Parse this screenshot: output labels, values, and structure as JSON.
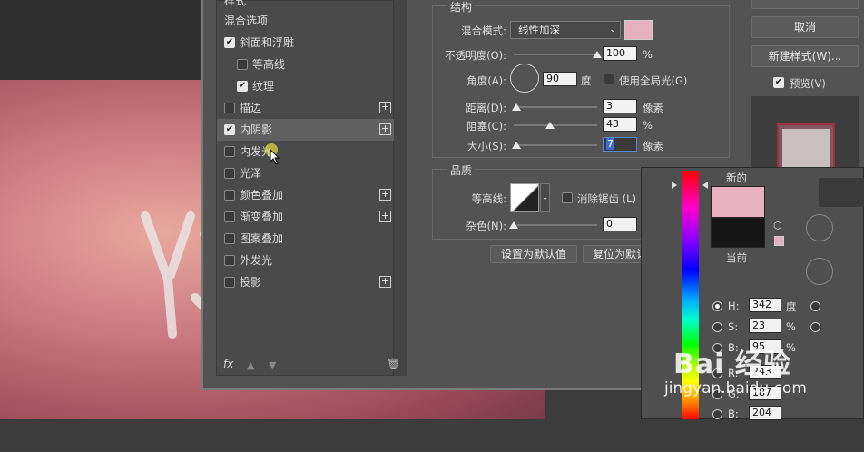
{
  "left_panel": {
    "header": "样式",
    "items": [
      {
        "label": "混合选项",
        "checkbox": false,
        "checked": false,
        "indent": 0,
        "plus": false
      },
      {
        "label": "斜面和浮雕",
        "checkbox": true,
        "checked": true,
        "indent": 0,
        "plus": false
      },
      {
        "label": "等高线",
        "checkbox": true,
        "checked": false,
        "indent": 1,
        "plus": false
      },
      {
        "label": "纹理",
        "checkbox": true,
        "checked": true,
        "indent": 1,
        "plus": false
      },
      {
        "label": "描边",
        "checkbox": true,
        "checked": false,
        "indent": 0,
        "plus": true
      },
      {
        "label": "内阴影",
        "checkbox": true,
        "checked": true,
        "indent": 0,
        "plus": true,
        "selected": true
      },
      {
        "label": "内发光",
        "checkbox": true,
        "checked": false,
        "indent": 0,
        "plus": false
      },
      {
        "label": "光泽",
        "checkbox": true,
        "checked": false,
        "indent": 0,
        "plus": false
      },
      {
        "label": "颜色叠加",
        "checkbox": true,
        "checked": false,
        "indent": 0,
        "plus": true
      },
      {
        "label": "渐变叠加",
        "checkbox": true,
        "checked": false,
        "indent": 0,
        "plus": true
      },
      {
        "label": "图案叠加",
        "checkbox": true,
        "checked": false,
        "indent": 0,
        "plus": false
      },
      {
        "label": "外发光",
        "checkbox": true,
        "checked": false,
        "indent": 0,
        "plus": false
      },
      {
        "label": "投影",
        "checkbox": true,
        "checked": false,
        "indent": 0,
        "plus": true
      }
    ],
    "fx_label": "fx"
  },
  "structure": {
    "title": "结构",
    "blend_mode_label": "混合模式:",
    "blend_mode_value": "线性加深",
    "opacity_label": "不透明度(O):",
    "opacity_value": "100",
    "opacity_unit": "%",
    "opacity_fraction": 1.0,
    "angle_label": "角度(A):",
    "angle_value": "90",
    "angle_unit": "度",
    "global_light_label": "使用全局光(G)",
    "distance_label": "距离(D):",
    "distance_value": "3",
    "distance_unit": "像素",
    "distance_fraction": 0.03,
    "choke_label": "阻塞(C):",
    "choke_value": "43",
    "choke_unit": "%",
    "choke_fraction": 0.43,
    "size_label": "大小(S):",
    "size_value": "7",
    "size_unit": "像素",
    "size_fraction": 0.03,
    "color_swatch": "#e7b0c1"
  },
  "quality": {
    "title": "品质",
    "contour_label": "等高线:",
    "antialias_label": "消除锯齿 (L)",
    "noise_label": "杂色(N):",
    "noise_value": "0",
    "noise_unit": "%",
    "noise_fraction": 0.0
  },
  "buttons": {
    "set_default": "设置为默认值",
    "reset_default": "复位为默认值",
    "cancel": "取消",
    "new_style": "新建样式(W)...",
    "preview": "预览(V)"
  },
  "color_picker": {
    "new_label": "新的",
    "current_label": "当前",
    "new_color": "#e7b0c1",
    "current_color": "#151515",
    "h_label": "H:",
    "h_value": "342",
    "h_unit": "度",
    "s_label": "S:",
    "s_value": "23",
    "s_unit": "%",
    "b_label": "B:",
    "b_value": "95",
    "b_unit": "%",
    "r_label": "R:",
    "r_value": "243",
    "g_label": "G:",
    "g_value": "187",
    "bb_label": "B:",
    "bb_value": "204"
  },
  "watermark": {
    "brand": "Bai 经验",
    "url": "jingyan.baidu.com"
  }
}
